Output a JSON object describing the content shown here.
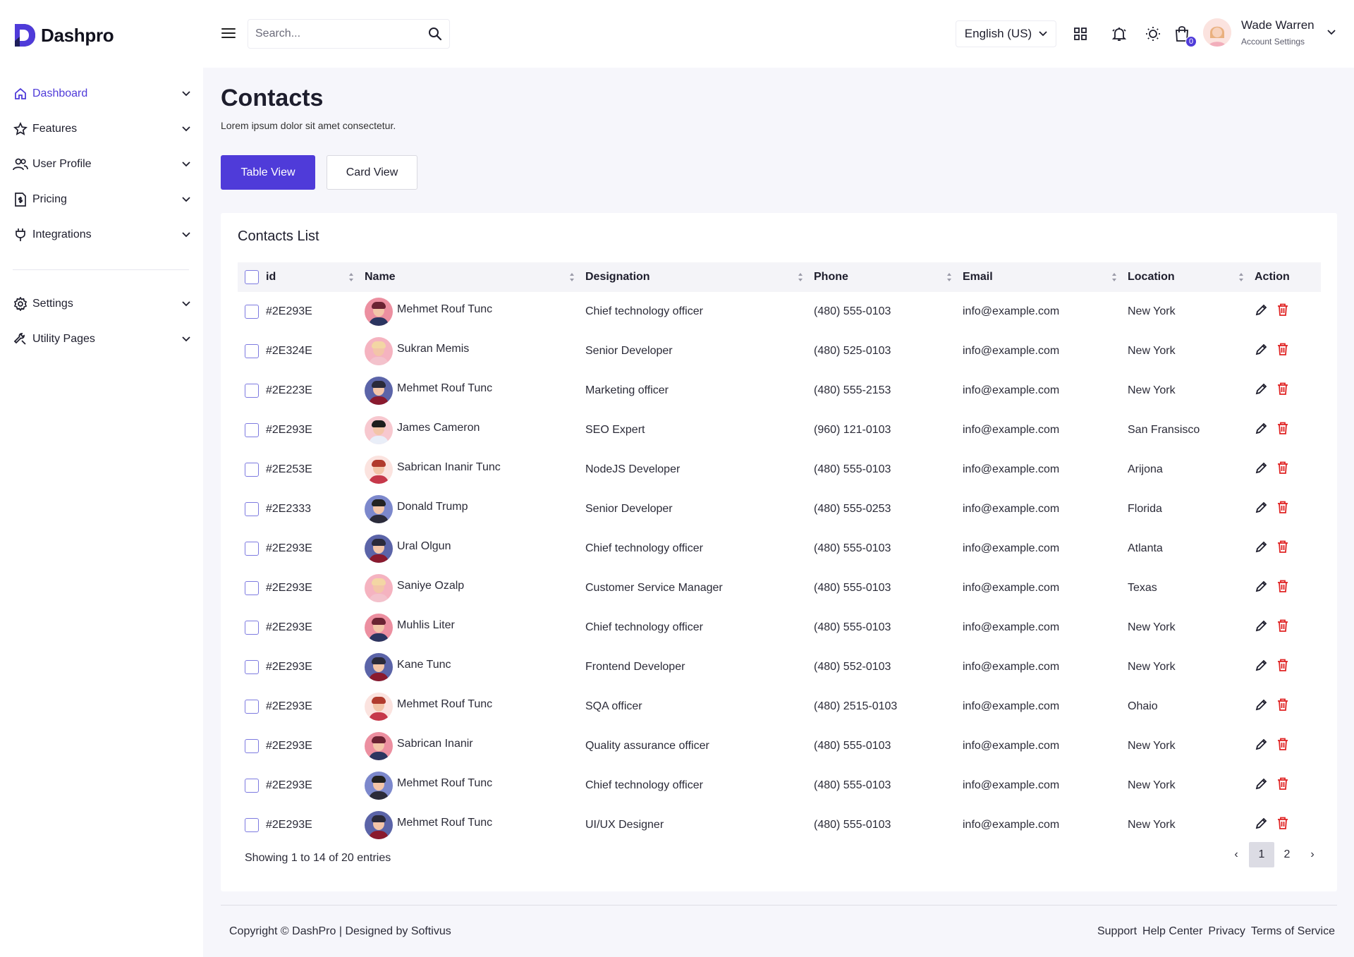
{
  "brand": {
    "name": "Dashpro",
    "accent": "#4f3bd9"
  },
  "header": {
    "search_placeholder": "Search...",
    "language": "English (US)",
    "cart_count": "0",
    "user_name": "Wade Warren",
    "user_sub": "Account Settings"
  },
  "sidebar": {
    "items": [
      {
        "label": "Dashboard",
        "icon": "home-icon"
      },
      {
        "label": "Features",
        "icon": "star-icon"
      },
      {
        "label": "User Profile",
        "icon": "users-icon"
      },
      {
        "label": "Pricing",
        "icon": "invoice-icon"
      },
      {
        "label": "Integrations",
        "icon": "plug-icon"
      },
      {
        "label": "Settings",
        "icon": "gear-icon"
      },
      {
        "label": "Utility Pages",
        "icon": "wrench-icon"
      }
    ]
  },
  "page": {
    "title": "Contacts",
    "subtitle": "Lorem ipsum dolor sit amet consectetur.",
    "table_view_label": "Table View",
    "card_view_label": "Card View"
  },
  "contacts": {
    "title": "Contacts List",
    "columns": [
      "id",
      "Name",
      "Designation",
      "Phone",
      "Email",
      "Location",
      "Action"
    ],
    "rows": [
      {
        "id": "#2E293E",
        "name": "Mehmet Rouf Tunc",
        "designation": "Chief technology officer",
        "phone": "(480) 555-0103",
        "email": "info@example.com",
        "location": "New York",
        "avatar": "female"
      },
      {
        "id": "#2E324E",
        "name": "Sukran Memis",
        "designation": "Senior Developer",
        "phone": "(480) 525-0103",
        "email": "info@example.com",
        "location": "New York",
        "avatar": "pink"
      },
      {
        "id": "#2E223E",
        "name": "Mehmet Rouf Tunc",
        "designation": "Marketing officer",
        "phone": "(480) 555-2153",
        "email": "info@example.com",
        "location": "New York",
        "avatar": "male"
      },
      {
        "id": "#2E293E",
        "name": "James Cameron",
        "designation": "SEO Expert",
        "phone": "(960) 121-0103",
        "email": "info@example.com",
        "location": "San Fransisco",
        "avatar": "tie"
      },
      {
        "id": "#2E253E",
        "name": "Sabrican Inanir Tunc",
        "designation": "NodeJS Developer",
        "phone": "(480) 555-0103",
        "email": "info@example.com",
        "location": "Arijona",
        "avatar": "redhead"
      },
      {
        "id": "#2E2333",
        "name": "Donald Trump",
        "designation": "Senior Developer",
        "phone": "(480) 555-0253",
        "email": "info@example.com",
        "location": "Florida",
        "avatar": "glasses"
      },
      {
        "id": "#2E293E",
        "name": "Ural Olgun",
        "designation": "Chief technology officer",
        "phone": "(480) 555-0103",
        "email": "info@example.com",
        "location": "Atlanta",
        "avatar": "male"
      },
      {
        "id": "#2E293E",
        "name": "Saniye Ozalp",
        "designation": "Customer Service Manager",
        "phone": "(480) 555-0103",
        "email": "info@example.com",
        "location": "Texas",
        "avatar": "pink"
      },
      {
        "id": "#2E293E",
        "name": "Muhlis Liter",
        "designation": "Chief technology officer",
        "phone": "(480) 555-0103",
        "email": "info@example.com",
        "location": "New York",
        "avatar": "female"
      },
      {
        "id": "#2E293E",
        "name": "Kane Tunc",
        "designation": "Frontend Developer",
        "phone": "(480) 552-0103",
        "email": "info@example.com",
        "location": "New York",
        "avatar": "male"
      },
      {
        "id": "#2E293E",
        "name": "Mehmet Rouf Tunc",
        "designation": "SQA officer",
        "phone": "(480) 2515-0103",
        "email": "info@example.com",
        "location": "Ohaio",
        "avatar": "redhead"
      },
      {
        "id": "#2E293E",
        "name": "Sabrican Inanir",
        "designation": "Quality assurance officer",
        "phone": "(480) 555-0103",
        "email": "info@example.com",
        "location": "New York",
        "avatar": "female"
      },
      {
        "id": "#2E293E",
        "name": "Mehmet Rouf Tunc",
        "designation": "Chief technology officer",
        "phone": "(480) 555-0103",
        "email": "info@example.com",
        "location": "New York",
        "avatar": "glasses"
      },
      {
        "id": "#2E293E",
        "name": "Mehmet Rouf Tunc",
        "designation": "UI/UX Designer",
        "phone": "(480) 555-0103",
        "email": "info@example.com",
        "location": "New York",
        "avatar": "male"
      }
    ],
    "showing": "Showing 1 to 14 of 20 entries",
    "pagination": {
      "prev": "‹",
      "pages": [
        "1",
        "2"
      ],
      "next": "›",
      "current": "1"
    }
  },
  "footer": {
    "copyright": "Copyright © DashPro | Designed by Softivus",
    "links": [
      "Support",
      "Help Center",
      "Privacy",
      "Terms of Service"
    ]
  }
}
